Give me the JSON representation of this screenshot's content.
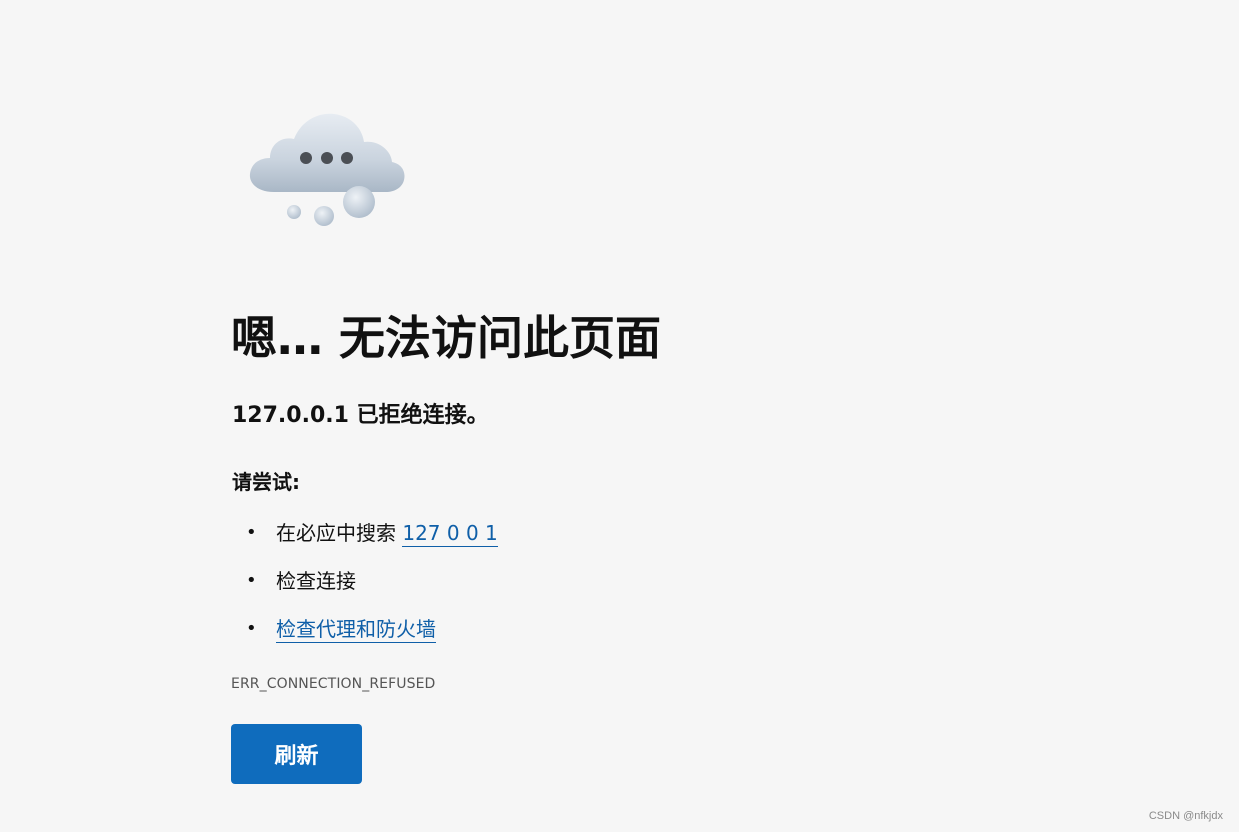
{
  "page": {
    "title": "嗯… 无法访问此页面",
    "subtitle": "127.0.0.1 已拒绝连接。",
    "try_heading": "请尝试:",
    "suggestions": [
      {
        "prefix": "在必应中搜索 ",
        "link": "127 0 0 1"
      },
      {
        "prefix": "检查连接",
        "link": ""
      },
      {
        "prefix": "",
        "link": "检查代理和防火墙"
      }
    ],
    "bullet": "•",
    "error_code": "ERR_CONNECTION_REFUSED",
    "refresh_label": "刷新"
  },
  "watermark": "CSDN @nfkjdx",
  "icons": {
    "main_illustration": "cloud-ellipsis-icon"
  },
  "colors": {
    "background": "#f6f6f6",
    "link": "#0f5fa8",
    "button": "#0f6cbd",
    "button_text": "#ffffff"
  }
}
